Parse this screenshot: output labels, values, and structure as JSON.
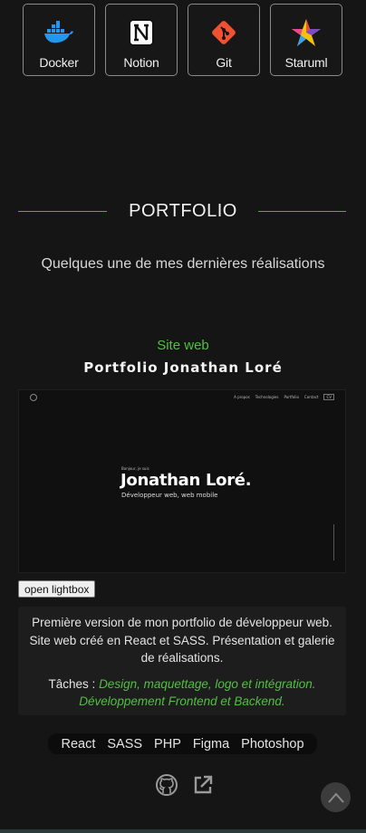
{
  "tools": [
    {
      "label": "Docker",
      "icon": "docker-icon"
    },
    {
      "label": "Notion",
      "icon": "notion-icon"
    },
    {
      "label": "Git",
      "icon": "git-icon"
    },
    {
      "label": "Staruml",
      "icon": "staruml-icon"
    }
  ],
  "portfolio": {
    "heading": "PORTFOLIO",
    "subtitle": "Quelques une de mes dernières réalisations"
  },
  "project": {
    "category": "Site web",
    "title": "Portfolio Jonathan Loré",
    "preview": {
      "nav": [
        "A propos",
        "Technologies",
        "Portfolio",
        "Contact"
      ],
      "kicker": "Bonjour, je suis",
      "name": "Jonathan Loré.",
      "tagline": "Développeur web, web mobile"
    },
    "lightbox_label": "open lightbox",
    "description": "Première version de mon portfolio de développeur web. Site web créé en React et SASS. Présentation et galerie de réalisations.",
    "tasks_label": "Tâches :",
    "tasks": "Design, maquettage, logo et intégration. Développement Frontend et Backend.",
    "technologies": [
      "React",
      "SASS",
      "PHP",
      "Figma",
      "Photoshop"
    ]
  },
  "colors": {
    "background": "#151515",
    "accent": "#4fc13f"
  }
}
